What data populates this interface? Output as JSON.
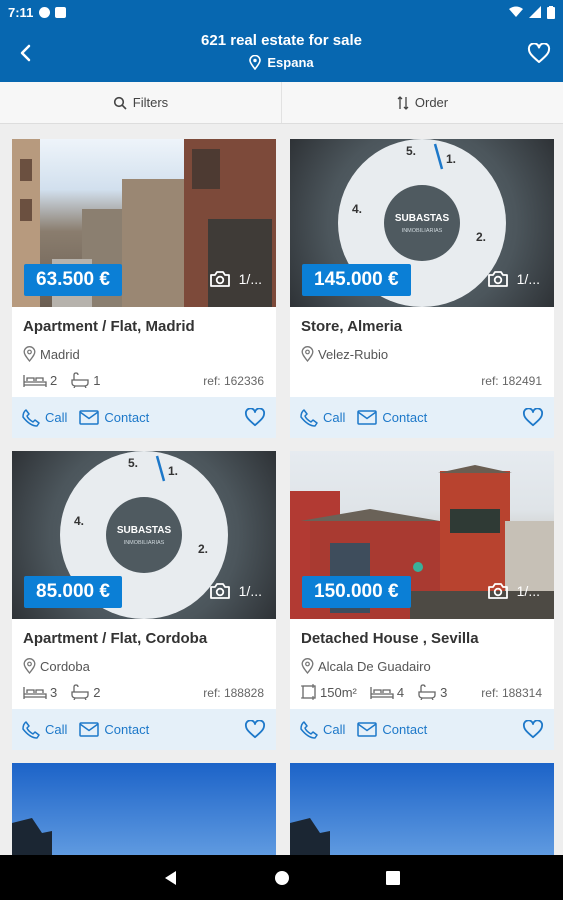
{
  "status": {
    "time": "7:11"
  },
  "header": {
    "title": "621 real estate for sale",
    "location": "Espana"
  },
  "toolbar": {
    "filters": "Filters",
    "order": "Order"
  },
  "actions": {
    "call": "Call",
    "contact": "Contact"
  },
  "colors": {
    "primary": "#0767b0",
    "price_badge": "#0b7fd6",
    "action_bar": "#e5f0f9",
    "action_text": "#1d78c9"
  },
  "icons": [
    "back-arrow-icon",
    "heart-icon",
    "location-pin-icon",
    "search-icon",
    "sort-icon",
    "camera-icon",
    "bed-icon",
    "bath-icon",
    "area-icon",
    "phone-icon",
    "mail-icon"
  ],
  "listings": [
    {
      "price": "63.500 €",
      "photos": "1/...",
      "title": "Apartment / Flat, Madrid",
      "location": "Madrid",
      "area": "",
      "beds": "2",
      "baths": "1",
      "ref": "ref: 162336"
    },
    {
      "price": "145.000 €",
      "photos": "1/...",
      "title": "Store, Almeria",
      "location": "Velez-Rubio",
      "area": "",
      "beds": "",
      "baths": "",
      "ref": "ref: 182491"
    },
    {
      "price": "85.000 €",
      "photos": "1/...",
      "title": "Apartment / Flat, Cordoba",
      "location": "Cordoba",
      "area": "",
      "beds": "3",
      "baths": "2",
      "ref": "ref: 188828"
    },
    {
      "price": "150.000 €",
      "photos": "1/...",
      "title": "Detached House , Sevilla",
      "location": "Alcala De Guadairo",
      "area": "150m²",
      "beds": "4",
      "baths": "3",
      "ref": "ref: 188314"
    }
  ]
}
